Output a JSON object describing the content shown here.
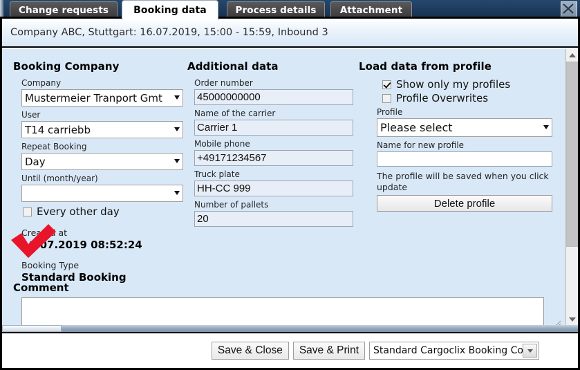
{
  "window": {
    "close_icon": "close-icon"
  },
  "tabs": [
    {
      "label": "Change requests",
      "active": false
    },
    {
      "label": "Booking data",
      "active": true
    },
    {
      "label": "Process details",
      "active": false
    },
    {
      "label": "Attachment",
      "active": false
    }
  ],
  "header": {
    "title": "Company ABC, Stuttgart: 16.07.2019, 15:00 - 15:59, Inbound 3"
  },
  "booking_company": {
    "heading": "Booking Company",
    "company_label": "Company",
    "company_value": "Mustermeier Tranport Gmt",
    "user_label": "User",
    "user_value": "T14 carriebb",
    "repeat_label": "Repeat Booking",
    "repeat_value": "Day",
    "until_label": "Until (month/year)",
    "until_value": "",
    "every_other_day_label": "Every other day",
    "every_other_day_checked": false,
    "created_at_label": "Created at",
    "created_at_value": "16.07.2019 08:52:24",
    "booking_type_label": "Booking Type",
    "booking_type_value": "Standard Booking"
  },
  "additional_data": {
    "heading": "Additional data",
    "fields": [
      {
        "label": "Order number",
        "value": "45000000000"
      },
      {
        "label": "Name of the carrier",
        "value": "Carrier 1"
      },
      {
        "label": "Mobile phone",
        "value": "+49171234567"
      },
      {
        "label": "Truck plate",
        "value": "HH-CC 999"
      },
      {
        "label": "Number of pallets",
        "value": "20"
      }
    ]
  },
  "profile": {
    "heading": "Load data from profile",
    "show_only_mine_label": "Show only my profiles",
    "show_only_mine_checked": true,
    "overwrites_label": "Profile Overwrites",
    "overwrites_checked": false,
    "profile_label": "Profile",
    "profile_value": "Please select",
    "new_profile_label": "Name for new profile",
    "new_profile_value": "",
    "hint": "The profile will be saved when you click update",
    "delete_label": "Delete profile"
  },
  "comment": {
    "heading": "Comment",
    "value": "",
    "placeholder": ""
  },
  "footer": {
    "save_close_label": "Save & Close",
    "save_print_label": "Save & Print",
    "doc_select_value": "Standard Cargoclix Booking Conf"
  },
  "annotation": {
    "type": "red-checkmark",
    "color": "#e8142a"
  },
  "colors": {
    "titlebar": "#1d3c5f",
    "panel_bg": "#d9e8f7",
    "header_strip": "#d7e7f7",
    "input_bg": "#e8eef7",
    "accent_red": "#e8142a"
  }
}
